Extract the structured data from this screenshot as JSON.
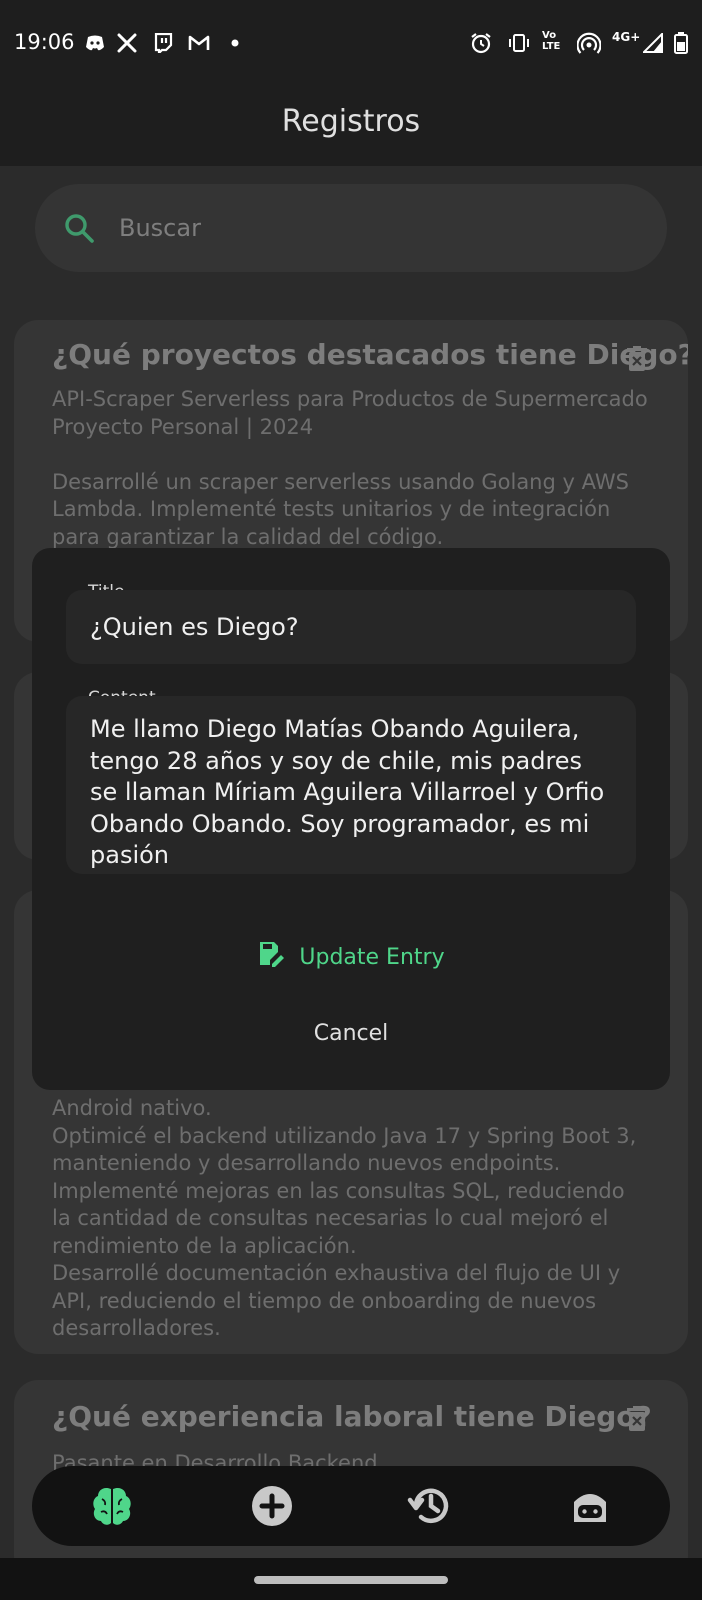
{
  "status_bar": {
    "time": "19:06",
    "left_icons": [
      "discord-icon",
      "x-icon",
      "twitch-icon",
      "gmail-icon",
      "dot-icon"
    ],
    "right_icons": [
      "alarm-icon",
      "vibrate-icon",
      "volte-icon",
      "hotspot-icon",
      "signal-icon",
      "battery-icon"
    ],
    "volte_text": "Vo\nLTE",
    "network_text": "4G+"
  },
  "app_bar": {
    "title": "Registros"
  },
  "search": {
    "placeholder": "Buscar"
  },
  "cards": [
    {
      "title": "¿Qué proyectos destacados tiene Diego?",
      "body": "API-Scraper Serverless para Productos de Supermercado\n Proyecto Personal | 2024\n\nDesarrollé un scraper serverless usando Golang y AWS Lambda. Implementé tests unitarios y de integración para garantizar la calidad del código."
    },
    {
      "title": "",
      "body": ""
    },
    {
      "title": "",
      "body": "Android nativo.\nOptimicé el backend utilizando Java 17 y Spring Boot 3, manteniendo y desarrollando nuevos endpoints.\nImplementé mejoras en las consultas SQL, reduciendo la cantidad de consultas necesarias lo cual mejoró el rendimiento de la aplicación.\nDesarrollé documentación exhaustiva del flujo de UI y API, reduciendo el tiempo de onboarding de nuevos desarrolladores."
    },
    {
      "title": "¿Qué experiencia laboral tiene Diego?",
      "body": "Pasante en Desarrollo Backend"
    }
  ],
  "dialog": {
    "title_label": "Title",
    "title_value": "¿Quien es Diego?",
    "content_label": "Content",
    "content_value": "Me llamo Diego Matías Obando Aguilera, tengo 28 años y soy de chile, mis padres se llaman Míriam Aguilera Villarroel y Orfio Obando Obando. Soy programador, es mi pasión",
    "update_label": "Update Entry",
    "cancel_label": "Cancel"
  },
  "bottom_nav": {
    "items": [
      "brain-icon",
      "add-circle-icon",
      "history-icon",
      "robot-face-icon"
    ],
    "active_index": 0
  },
  "colors": {
    "accent": "#4fd68a",
    "background": "#2b2b2b",
    "bar": "#1e1e1e",
    "dialog": "#1f1f1f",
    "card": "#353535"
  }
}
